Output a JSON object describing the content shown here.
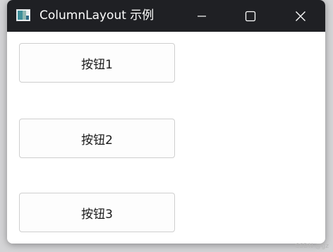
{
  "window": {
    "title": "ColumnLayout 示例",
    "icon": "app-window-icon",
    "controls": {
      "minimize_icon": "minimize-icon",
      "maximize_icon": "maximize-icon",
      "close_icon": "close-icon"
    }
  },
  "buttons": [
    {
      "label": "按钮1"
    },
    {
      "label": "按钮2"
    },
    {
      "label": "按钮3"
    }
  ],
  "watermark": "CSDN @gz",
  "colors": {
    "titlebar": "#1f2024",
    "title_text": "#ffffff",
    "content_bg": "#ffffff",
    "button_bg": "#fdfdfd",
    "button_border": "#cfcfcf"
  }
}
